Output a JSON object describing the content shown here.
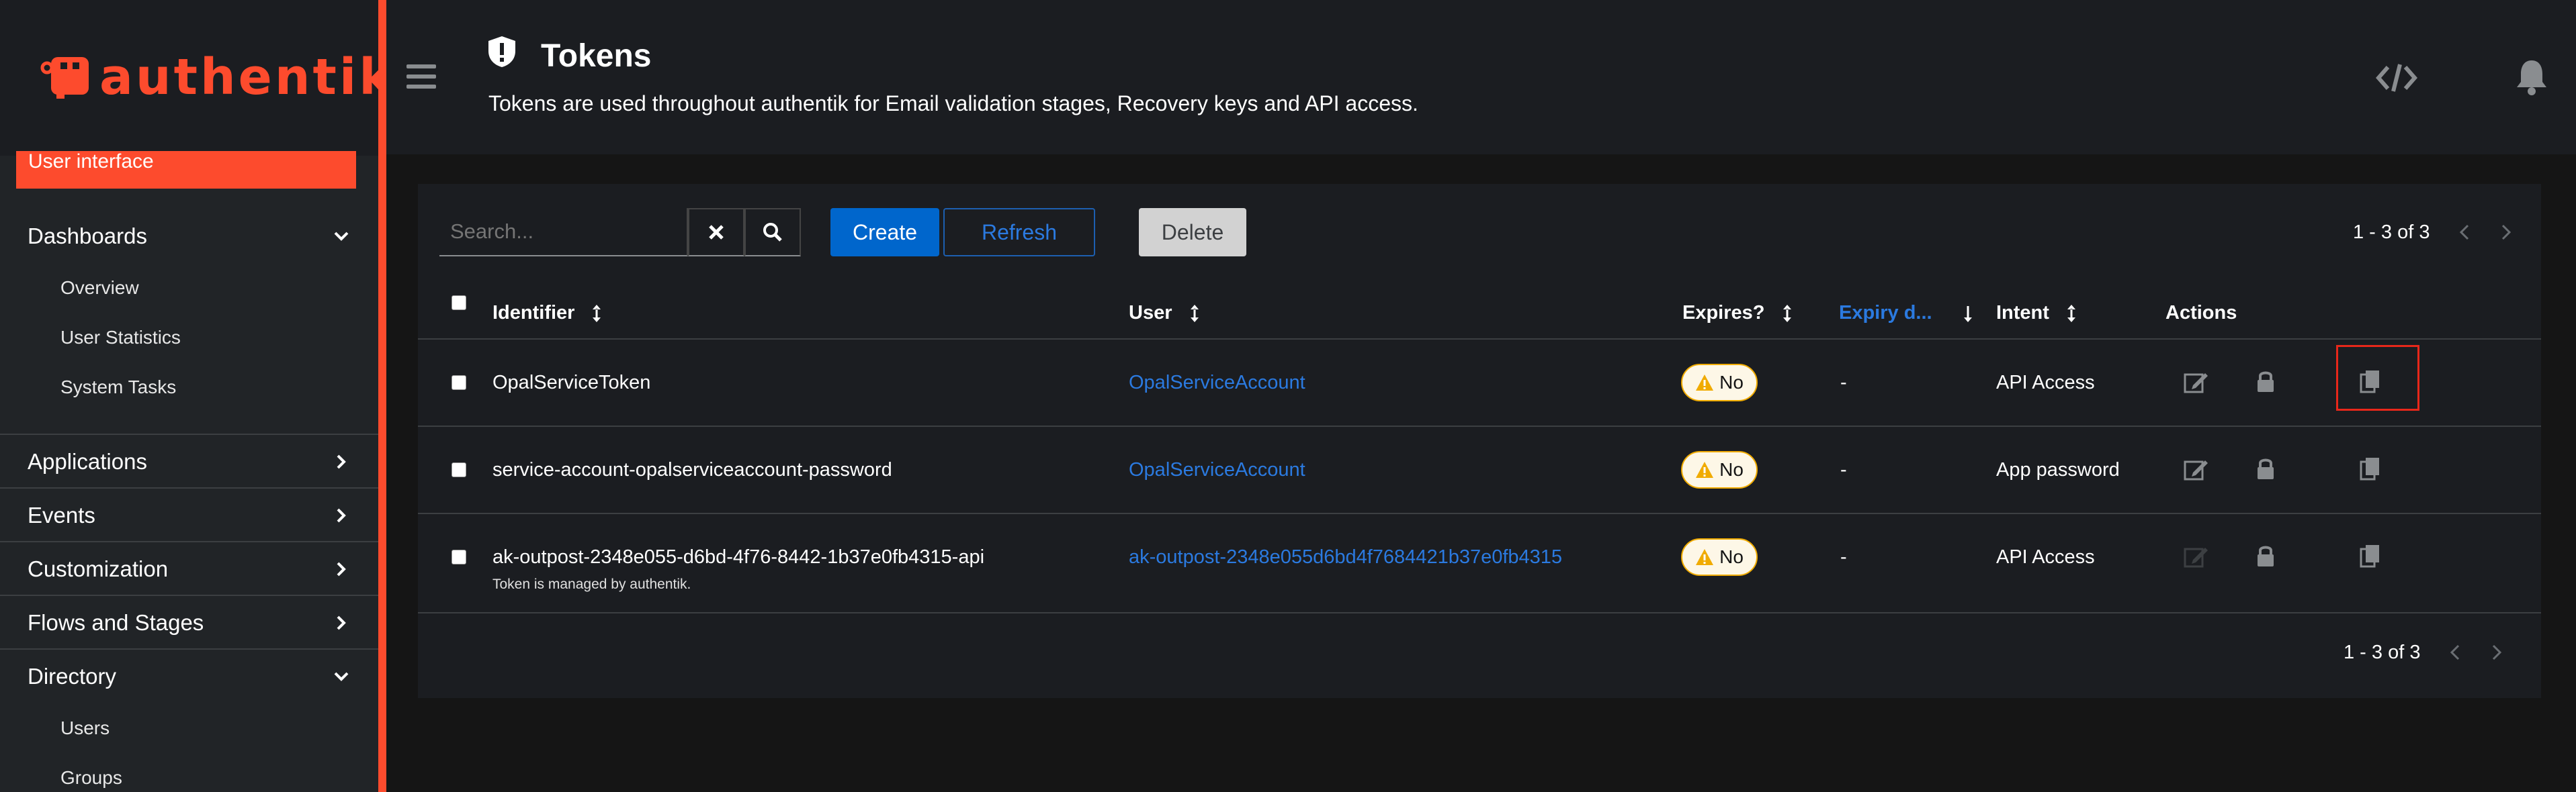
{
  "brand": {
    "name": "authentik"
  },
  "sidebar": {
    "current": "User interface",
    "groups": [
      {
        "label": "Dashboards",
        "expanded": true,
        "items": [
          "Overview",
          "User Statistics",
          "System Tasks"
        ]
      },
      {
        "label": "Applications",
        "expanded": false
      },
      {
        "label": "Events",
        "expanded": false
      },
      {
        "label": "Customization",
        "expanded": false
      },
      {
        "label": "Flows and Stages",
        "expanded": false
      },
      {
        "label": "Directory",
        "expanded": true,
        "items": [
          "Users",
          "Groups"
        ]
      }
    ]
  },
  "header": {
    "title": "Tokens",
    "description": "Tokens are used throughout authentik for Email validation stages, Recovery keys and API access."
  },
  "toolbar": {
    "search_placeholder": "Search...",
    "create_label": "Create",
    "refresh_label": "Refresh",
    "delete_label": "Delete",
    "pagination": "1 - 3 of 3"
  },
  "table": {
    "columns": [
      "Identifier",
      "User",
      "Expires?",
      "Expiry d...",
      "Intent",
      "Actions"
    ],
    "rows": [
      {
        "identifier": "OpalServiceToken",
        "note": "",
        "user": "OpalServiceAccount",
        "expires": "No",
        "expiry_date": "-",
        "intent": "API Access"
      },
      {
        "identifier": "service-account-opalserviceaccount-password",
        "note": "",
        "user": "OpalServiceAccount",
        "expires": "No",
        "expiry_date": "-",
        "intent": "App password"
      },
      {
        "identifier": "ak-outpost-2348e055-d6bd-4f76-8442-1b37e0fb4315-api",
        "note": "Token is managed by authentik.",
        "user": "ak-outpost-2348e055d6bd4f7684421b37e0fb4315",
        "expires": "No",
        "expiry_date": "-",
        "intent": "API Access"
      }
    ]
  },
  "footer": {
    "pagination": "1 - 3 of 3"
  },
  "colors": {
    "accent": "#fd4b2d",
    "primary": "#0066cc",
    "link": "#2b7ae0",
    "warning": "#f0ab00",
    "highlight": "#e8271a"
  }
}
